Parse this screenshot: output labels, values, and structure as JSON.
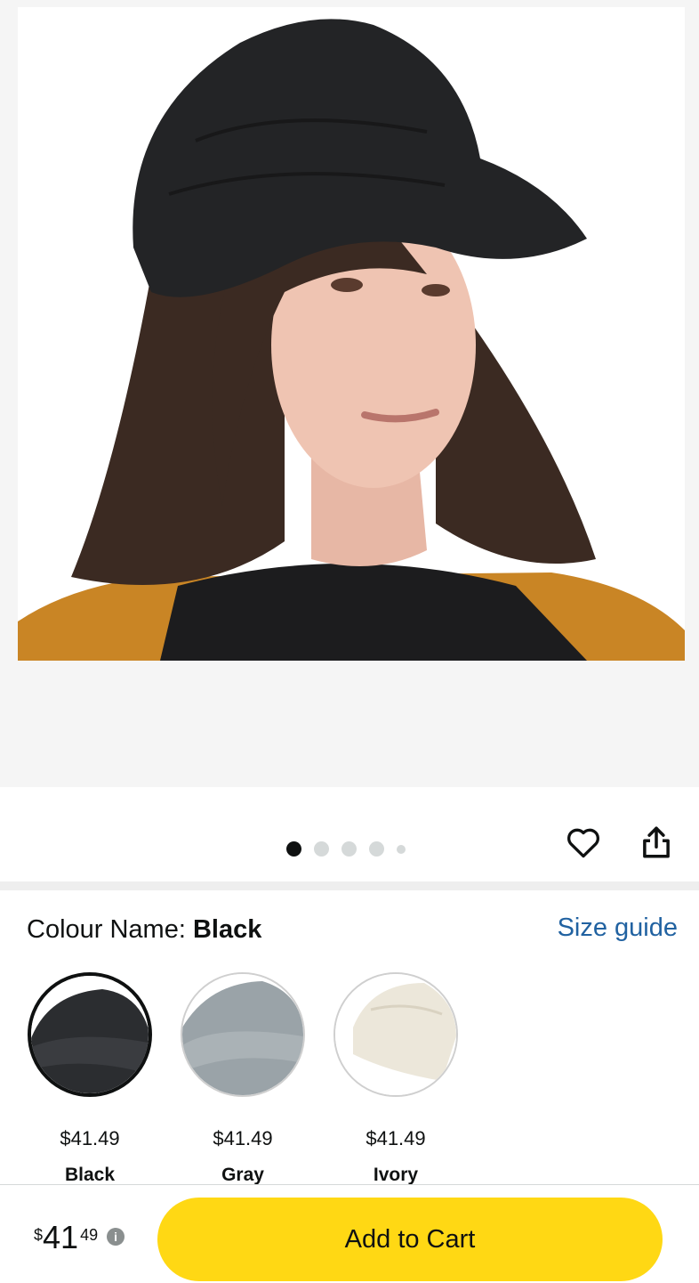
{
  "product": {
    "image_count": 5,
    "active_image_index": 0
  },
  "variant": {
    "label": "Colour Name: ",
    "selected": "Black",
    "size_guide": "Size guide",
    "options": [
      {
        "price": "$41.49",
        "name": "Black",
        "color": "#2b2d30"
      },
      {
        "price": "$41.49",
        "name": "Gray",
        "color": "#9aa3a8"
      },
      {
        "price": "$41.49",
        "name": "Ivory",
        "color": "#ece7da"
      }
    ]
  },
  "purchase": {
    "currency_symbol": "$",
    "price_whole": "41",
    "price_fraction": "49",
    "info_icon_label": "i",
    "add_to_cart": "Add to Cart",
    "button_color": "#ffd814"
  },
  "icons": [
    "heart-icon",
    "share-icon",
    "info-icon"
  ]
}
